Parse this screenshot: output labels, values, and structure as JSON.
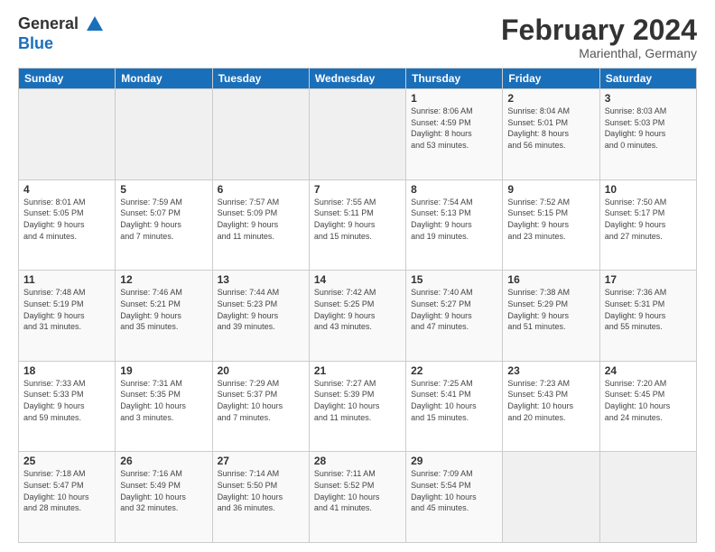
{
  "logo": {
    "line1": "General",
    "line2": "Blue"
  },
  "title": "February 2024",
  "location": "Marienthal, Germany",
  "headers": [
    "Sunday",
    "Monday",
    "Tuesday",
    "Wednesday",
    "Thursday",
    "Friday",
    "Saturday"
  ],
  "weeks": [
    [
      {
        "day": "",
        "detail": ""
      },
      {
        "day": "",
        "detail": ""
      },
      {
        "day": "",
        "detail": ""
      },
      {
        "day": "",
        "detail": ""
      },
      {
        "day": "1",
        "detail": "Sunrise: 8:06 AM\nSunset: 4:59 PM\nDaylight: 8 hours\nand 53 minutes."
      },
      {
        "day": "2",
        "detail": "Sunrise: 8:04 AM\nSunset: 5:01 PM\nDaylight: 8 hours\nand 56 minutes."
      },
      {
        "day": "3",
        "detail": "Sunrise: 8:03 AM\nSunset: 5:03 PM\nDaylight: 9 hours\nand 0 minutes."
      }
    ],
    [
      {
        "day": "4",
        "detail": "Sunrise: 8:01 AM\nSunset: 5:05 PM\nDaylight: 9 hours\nand 4 minutes."
      },
      {
        "day": "5",
        "detail": "Sunrise: 7:59 AM\nSunset: 5:07 PM\nDaylight: 9 hours\nand 7 minutes."
      },
      {
        "day": "6",
        "detail": "Sunrise: 7:57 AM\nSunset: 5:09 PM\nDaylight: 9 hours\nand 11 minutes."
      },
      {
        "day": "7",
        "detail": "Sunrise: 7:55 AM\nSunset: 5:11 PM\nDaylight: 9 hours\nand 15 minutes."
      },
      {
        "day": "8",
        "detail": "Sunrise: 7:54 AM\nSunset: 5:13 PM\nDaylight: 9 hours\nand 19 minutes."
      },
      {
        "day": "9",
        "detail": "Sunrise: 7:52 AM\nSunset: 5:15 PM\nDaylight: 9 hours\nand 23 minutes."
      },
      {
        "day": "10",
        "detail": "Sunrise: 7:50 AM\nSunset: 5:17 PM\nDaylight: 9 hours\nand 27 minutes."
      }
    ],
    [
      {
        "day": "11",
        "detail": "Sunrise: 7:48 AM\nSunset: 5:19 PM\nDaylight: 9 hours\nand 31 minutes."
      },
      {
        "day": "12",
        "detail": "Sunrise: 7:46 AM\nSunset: 5:21 PM\nDaylight: 9 hours\nand 35 minutes."
      },
      {
        "day": "13",
        "detail": "Sunrise: 7:44 AM\nSunset: 5:23 PM\nDaylight: 9 hours\nand 39 minutes."
      },
      {
        "day": "14",
        "detail": "Sunrise: 7:42 AM\nSunset: 5:25 PM\nDaylight: 9 hours\nand 43 minutes."
      },
      {
        "day": "15",
        "detail": "Sunrise: 7:40 AM\nSunset: 5:27 PM\nDaylight: 9 hours\nand 47 minutes."
      },
      {
        "day": "16",
        "detail": "Sunrise: 7:38 AM\nSunset: 5:29 PM\nDaylight: 9 hours\nand 51 minutes."
      },
      {
        "day": "17",
        "detail": "Sunrise: 7:36 AM\nSunset: 5:31 PM\nDaylight: 9 hours\nand 55 minutes."
      }
    ],
    [
      {
        "day": "18",
        "detail": "Sunrise: 7:33 AM\nSunset: 5:33 PM\nDaylight: 9 hours\nand 59 minutes."
      },
      {
        "day": "19",
        "detail": "Sunrise: 7:31 AM\nSunset: 5:35 PM\nDaylight: 10 hours\nand 3 minutes."
      },
      {
        "day": "20",
        "detail": "Sunrise: 7:29 AM\nSunset: 5:37 PM\nDaylight: 10 hours\nand 7 minutes."
      },
      {
        "day": "21",
        "detail": "Sunrise: 7:27 AM\nSunset: 5:39 PM\nDaylight: 10 hours\nand 11 minutes."
      },
      {
        "day": "22",
        "detail": "Sunrise: 7:25 AM\nSunset: 5:41 PM\nDaylight: 10 hours\nand 15 minutes."
      },
      {
        "day": "23",
        "detail": "Sunrise: 7:23 AM\nSunset: 5:43 PM\nDaylight: 10 hours\nand 20 minutes."
      },
      {
        "day": "24",
        "detail": "Sunrise: 7:20 AM\nSunset: 5:45 PM\nDaylight: 10 hours\nand 24 minutes."
      }
    ],
    [
      {
        "day": "25",
        "detail": "Sunrise: 7:18 AM\nSunset: 5:47 PM\nDaylight: 10 hours\nand 28 minutes."
      },
      {
        "day": "26",
        "detail": "Sunrise: 7:16 AM\nSunset: 5:49 PM\nDaylight: 10 hours\nand 32 minutes."
      },
      {
        "day": "27",
        "detail": "Sunrise: 7:14 AM\nSunset: 5:50 PM\nDaylight: 10 hours\nand 36 minutes."
      },
      {
        "day": "28",
        "detail": "Sunrise: 7:11 AM\nSunset: 5:52 PM\nDaylight: 10 hours\nand 41 minutes."
      },
      {
        "day": "29",
        "detail": "Sunrise: 7:09 AM\nSunset: 5:54 PM\nDaylight: 10 hours\nand 45 minutes."
      },
      {
        "day": "",
        "detail": ""
      },
      {
        "day": "",
        "detail": ""
      }
    ]
  ]
}
